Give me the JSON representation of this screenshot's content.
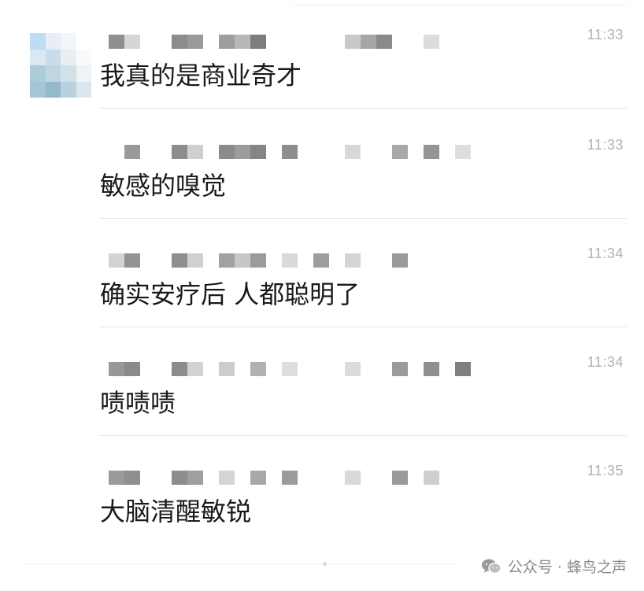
{
  "comments": [
    {
      "time": "11:33",
      "text": "我真的是商业奇才",
      "has_avatar": true,
      "nick_blocks": [
        {
          "at": 0,
          "shade": "#8f8f8f"
        },
        {
          "at": 1,
          "shade": "#d6d6d6"
        },
        {
          "at": 4,
          "shade": "#8c8c8c"
        },
        {
          "at": 5,
          "shade": "#9a9a9a"
        },
        {
          "at": 7,
          "shade": "#9e9e9e"
        },
        {
          "at": 8,
          "shade": "#b8b8b8"
        },
        {
          "at": 9,
          "shade": "#7d7d7d"
        },
        {
          "at": 15,
          "shade": "#c9c9c9"
        },
        {
          "at": 16,
          "shade": "#a6a6a6"
        },
        {
          "at": 17,
          "shade": "#8a8a8a"
        },
        {
          "at": 20,
          "shade": "#dcdcdc"
        }
      ]
    },
    {
      "time": "11:33",
      "text": "敏感的嗅觉",
      "has_avatar": false,
      "nick_blocks": [
        {
          "at": 1,
          "shade": "#9a9a9a"
        },
        {
          "at": 4,
          "shade": "#8d8d8d"
        },
        {
          "at": 5,
          "shade": "#cfcfcf"
        },
        {
          "at": 7,
          "shade": "#8b8b8b"
        },
        {
          "at": 8,
          "shade": "#9c9c9c"
        },
        {
          "at": 9,
          "shade": "#858585"
        },
        {
          "at": 11,
          "shade": "#8e8e8e"
        },
        {
          "at": 15,
          "shade": "#d8d8d8"
        },
        {
          "at": 18,
          "shade": "#a9a9a9"
        },
        {
          "at": 20,
          "shade": "#949494"
        },
        {
          "at": 22,
          "shade": "#dedede"
        }
      ]
    },
    {
      "time": "11:34",
      "text": "确实安疗后 人都聪明了",
      "has_avatar": false,
      "nick_blocks": [
        {
          "at": 0,
          "shade": "#d3d3d3"
        },
        {
          "at": 1,
          "shade": "#939393"
        },
        {
          "at": 4,
          "shade": "#8e8e8e"
        },
        {
          "at": 5,
          "shade": "#d0d0d0"
        },
        {
          "at": 7,
          "shade": "#a1a1a1"
        },
        {
          "at": 8,
          "shade": "#c7c7c7"
        },
        {
          "at": 9,
          "shade": "#9b9b9b"
        },
        {
          "at": 11,
          "shade": "#dadada"
        },
        {
          "at": 13,
          "shade": "#9d9d9d"
        },
        {
          "at": 15,
          "shade": "#d5d5d5"
        },
        {
          "at": 18,
          "shade": "#9a9a9a"
        }
      ]
    },
    {
      "time": "11:34",
      "text": "啧啧啧",
      "has_avatar": false,
      "nick_blocks": [
        {
          "at": 0,
          "shade": "#989898"
        },
        {
          "at": 1,
          "shade": "#8a8a8a"
        },
        {
          "at": 4,
          "shade": "#8c8c8c"
        },
        {
          "at": 5,
          "shade": "#d2d2d2"
        },
        {
          "at": 7,
          "shade": "#cccccc"
        },
        {
          "at": 9,
          "shade": "#b1b1b1"
        },
        {
          "at": 11,
          "shade": "#dddddd"
        },
        {
          "at": 15,
          "shade": "#dcdcdc"
        },
        {
          "at": 18,
          "shade": "#9b9b9b"
        },
        {
          "at": 20,
          "shade": "#8f8f8f"
        },
        {
          "at": 22,
          "shade": "#7f7f7f"
        }
      ]
    },
    {
      "time": "11:35",
      "text": "大脑清醒敏锐",
      "has_avatar": false,
      "nick_blocks": [
        {
          "at": 0,
          "shade": "#9a9a9a"
        },
        {
          "at": 1,
          "shade": "#8f8f8f"
        },
        {
          "at": 4,
          "shade": "#8d8d8d"
        },
        {
          "at": 5,
          "shade": "#9f9f9f"
        },
        {
          "at": 7,
          "shade": "#d5d5d5"
        },
        {
          "at": 9,
          "shade": "#a8a8a8"
        },
        {
          "at": 11,
          "shade": "#9c9c9c"
        },
        {
          "at": 15,
          "shade": "#dadada"
        },
        {
          "at": 18,
          "shade": "#9a9a9a"
        },
        {
          "at": 20,
          "shade": "#cfcfcf"
        }
      ]
    }
  ],
  "avatar_mosaic": [
    "#bcdcf2",
    "#e6eef5",
    "#f3f6f9",
    "#ffffff",
    "#d9e7f1",
    "#c6dbe8",
    "#e9eef3",
    "#f7f9fb",
    "#a9c9d8",
    "#bcd3df",
    "#cfe0e8",
    "#eef3f6",
    "#9fc3d2",
    "#8db7c8",
    "#b4d0dc",
    "#d9e6ec"
  ],
  "watermark": {
    "text": "公众号 · 蜂鸟之声",
    "icon": "wechat-icon"
  },
  "colors": {
    "timestamp": "#b2b2b2",
    "comment_text": "#1a1a1a",
    "divider": "#e6e6e6"
  }
}
